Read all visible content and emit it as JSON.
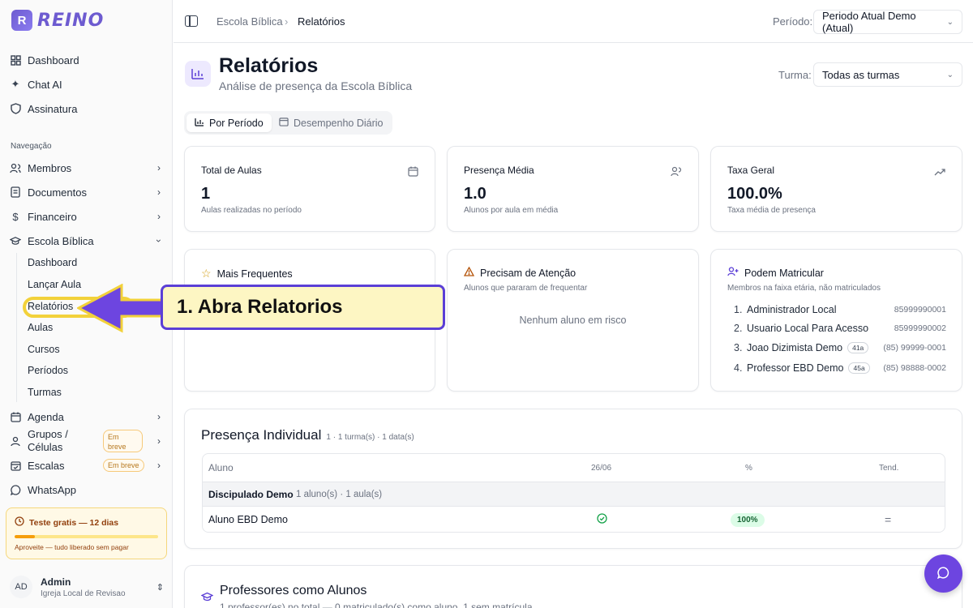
{
  "brand": {
    "name": "REINO",
    "mark": "R"
  },
  "sidebar": {
    "top": [
      {
        "label": "Dashboard",
        "icon": "grid-icon"
      },
      {
        "label": "Chat AI",
        "icon": "sparkles-icon"
      },
      {
        "label": "Assinatura",
        "icon": "shield-icon"
      }
    ],
    "section_label": "Navegação",
    "nav": [
      {
        "label": "Membros",
        "icon": "users-icon"
      },
      {
        "label": "Documentos",
        "icon": "document-icon"
      },
      {
        "label": "Financeiro",
        "icon": "dollar-icon"
      },
      {
        "label": "Escola Bíblica",
        "icon": "graduation-cap-icon"
      }
    ],
    "sub": [
      "Dashboard",
      "Lançar Aula",
      "Relatórios",
      "Aulas",
      "Cursos",
      "Períodos",
      "Turmas"
    ],
    "more": [
      {
        "label": "Agenda",
        "icon": "calendar-icon"
      },
      {
        "label": "Grupos / Células",
        "icon": "group-icon",
        "badge": "Em breve"
      },
      {
        "label": "Escalas",
        "icon": "calendar-check-icon",
        "badge": "Em breve"
      },
      {
        "label": "WhatsApp",
        "icon": "chat-bubble-icon"
      }
    ],
    "trial": {
      "title": "Teste gratis — 12 dias",
      "subtitle": "Aproveite — tudo liberado sem pagar",
      "progress": 0.14
    },
    "user": {
      "initials": "AD",
      "name": "Admin",
      "org": "Igreja Local de Revisao"
    }
  },
  "topbar": {
    "breadcrumb": [
      "Escola Bíblica",
      "Relatórios"
    ],
    "period_label": "Período:",
    "period_value": "Periodo Atual Demo (Atual)"
  },
  "header": {
    "title": "Relatórios",
    "subtitle": "Análise de presença da Escola Bíblica",
    "class_label": "Turma:",
    "class_value": "Todas as turmas"
  },
  "tabs": [
    {
      "label": "Por Período",
      "active": true
    },
    {
      "label": "Desempenho Diário",
      "active": false
    }
  ],
  "stats": [
    {
      "title": "Total de Aulas",
      "value": "1",
      "desc": "Aulas realizadas no período",
      "icon": "calendar-icon"
    },
    {
      "title": "Presença Média",
      "value": "1.0",
      "desc": "Alunos por aula em média",
      "icon": "users-icon"
    },
    {
      "title": "Taxa Geral",
      "value": "100.0%",
      "desc": "Taxa média de presença",
      "icon": "trending-up-icon"
    }
  ],
  "panels": {
    "frequent": {
      "title": "Mais Frequentes"
    },
    "attention": {
      "title": "Precisam de Atenção",
      "desc": "Alunos que pararam de frequentar",
      "empty": "Nenhum aluno em risco"
    },
    "enroll": {
      "title": "Podem Matricular",
      "desc": "Membros na faixa etária, não matriculados",
      "items": [
        {
          "num": "1.",
          "name": "Administrador Local",
          "age": "",
          "phone": "85999990001"
        },
        {
          "num": "2.",
          "name": "Usuario Local Para Acesso",
          "age": "",
          "phone": "85999990002"
        },
        {
          "num": "3.",
          "name": "Joao Dizimista Demo",
          "age": "41a",
          "phone": "(85) 99999-0001"
        },
        {
          "num": "4.",
          "name": "Professor EBD Demo",
          "age": "45a",
          "phone": "(85) 98888-0002"
        }
      ]
    }
  },
  "presence": {
    "title": "Presença Individual",
    "meta": "1 · 1 turma(s) · 1 data(s)",
    "columns": [
      "Aluno",
      "26/06",
      "%",
      "Tend."
    ],
    "group": {
      "name": "Discipulado Demo",
      "meta": "1 aluno(s) · 1 aula(s)"
    },
    "rows": [
      {
        "name": "Aluno EBD Demo",
        "pct": "100%",
        "trend": "="
      }
    ]
  },
  "teachers": {
    "title": "Professores como Alunos",
    "meta": "1 professor(es) no total — 0 matriculado(s) como aluno, 1 sem matrícula"
  },
  "callout": {
    "text": "1. Abra Relatorios"
  }
}
